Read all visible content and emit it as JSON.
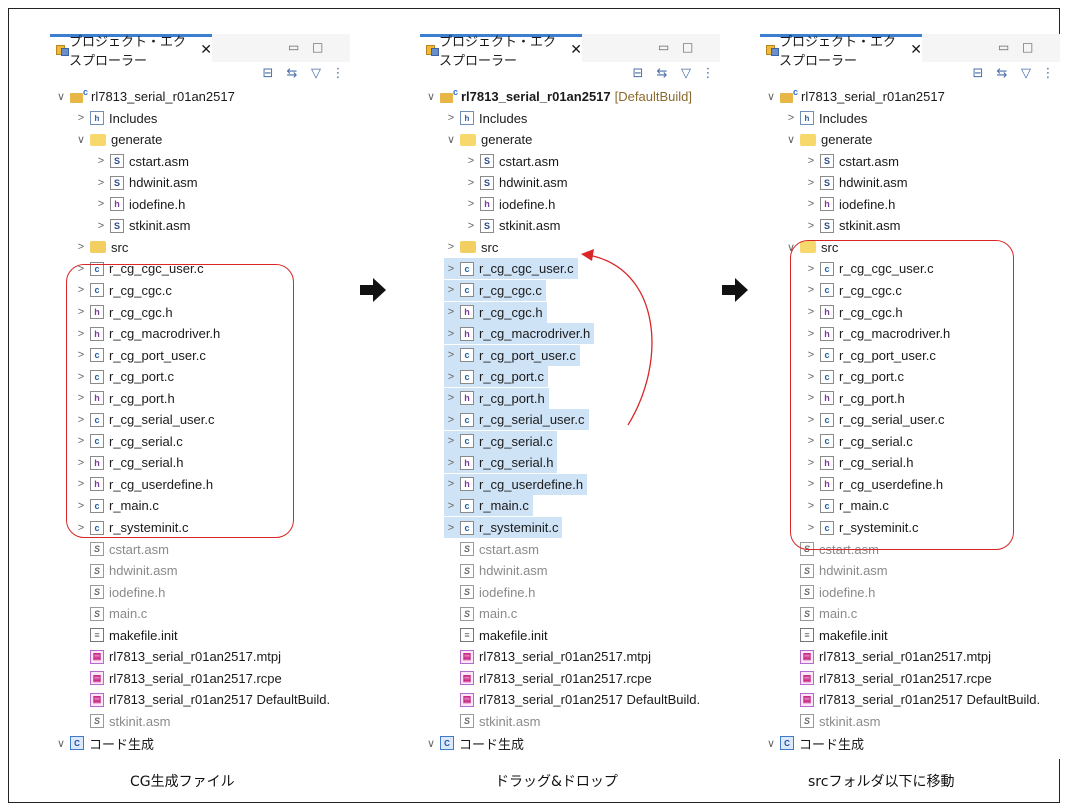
{
  "panels": [
    {
      "tab_title": "プロジェクト・エクスプローラー",
      "rows": [
        {
          "label": "rl7813_serial_r01an2517",
          "icon": "proj",
          "arrow": "∨",
          "indent": 0,
          "bold": false
        },
        {
          "label": "Includes",
          "icon": "inc",
          "arrow": ">",
          "indent": 1
        },
        {
          "label": "generate",
          "icon": "folder-open",
          "arrow": "∨",
          "indent": 1
        },
        {
          "label": "cstart.asm",
          "icon": "s",
          "arrow": ">",
          "indent": 2
        },
        {
          "label": "hdwinit.asm",
          "icon": "s",
          "arrow": ">",
          "indent": 2
        },
        {
          "label": "iodefine.h",
          "icon": "h",
          "arrow": ">",
          "indent": 2
        },
        {
          "label": "stkinit.asm",
          "icon": "s",
          "arrow": ">",
          "indent": 2
        },
        {
          "label": "src",
          "icon": "folder",
          "arrow": ">",
          "indent": 1
        },
        {
          "label": "r_cg_cgc_user.c",
          "icon": "c",
          "arrow": ">",
          "indent": 1
        },
        {
          "label": "r_cg_cgc.c",
          "icon": "c",
          "arrow": ">",
          "indent": 1
        },
        {
          "label": "r_cg_cgc.h",
          "icon": "h",
          "arrow": ">",
          "indent": 1
        },
        {
          "label": "r_cg_macrodriver.h",
          "icon": "h",
          "arrow": ">",
          "indent": 1
        },
        {
          "label": "r_cg_port_user.c",
          "icon": "c",
          "arrow": ">",
          "indent": 1
        },
        {
          "label": "r_cg_port.c",
          "icon": "c",
          "arrow": ">",
          "indent": 1
        },
        {
          "label": "r_cg_port.h",
          "icon": "h",
          "arrow": ">",
          "indent": 1
        },
        {
          "label": "r_cg_serial_user.c",
          "icon": "c",
          "arrow": ">",
          "indent": 1
        },
        {
          "label": "r_cg_serial.c",
          "icon": "c",
          "arrow": ">",
          "indent": 1
        },
        {
          "label": "r_cg_serial.h",
          "icon": "h",
          "arrow": ">",
          "indent": 1
        },
        {
          "label": "r_cg_userdefine.h",
          "icon": "h",
          "arrow": ">",
          "indent": 1
        },
        {
          "label": "r_main.c",
          "icon": "c",
          "arrow": ">",
          "indent": 1
        },
        {
          "label": "r_systeminit.c",
          "icon": "c",
          "arrow": ">",
          "indent": 1
        },
        {
          "label": "cstart.asm",
          "icon": "a",
          "arrow": "",
          "indent": 1,
          "dim": true
        },
        {
          "label": "hdwinit.asm",
          "icon": "a",
          "arrow": "",
          "indent": 1,
          "dim": true
        },
        {
          "label": "iodefine.h",
          "icon": "a",
          "arrow": "",
          "indent": 1,
          "dim": true
        },
        {
          "label": "main.c",
          "icon": "a",
          "arrow": "",
          "indent": 1,
          "dim": true
        },
        {
          "label": "makefile.init",
          "icon": "m",
          "arrow": "",
          "indent": 1
        },
        {
          "label": "rl7813_serial_r01an2517.mtpj",
          "icon": "p",
          "arrow": "",
          "indent": 1
        },
        {
          "label": "rl7813_serial_r01an2517.rcpe",
          "icon": "p",
          "arrow": "",
          "indent": 1
        },
        {
          "label": "rl7813_serial_r01an2517 DefaultBuild.",
          "icon": "p",
          "arrow": "",
          "indent": 1
        },
        {
          "label": "stkinit.asm",
          "icon": "a",
          "arrow": "",
          "indent": 1,
          "dim": true
        },
        {
          "label": "コード生成",
          "icon": "codegen",
          "arrow": "∨",
          "indent": 0
        }
      ],
      "caption": "CG生成ファイル"
    },
    {
      "tab_title": "プロジェクト・エクスプローラー",
      "rows": [
        {
          "label": "rl7813_serial_r01an2517",
          "suffix": "[DefaultBuild]",
          "icon": "proj",
          "arrow": "∨",
          "indent": 0,
          "bold": true
        },
        {
          "label": "Includes",
          "icon": "inc",
          "arrow": ">",
          "indent": 1
        },
        {
          "label": "generate",
          "icon": "folder-open",
          "arrow": "∨",
          "indent": 1
        },
        {
          "label": "cstart.asm",
          "icon": "s",
          "arrow": ">",
          "indent": 2
        },
        {
          "label": "hdwinit.asm",
          "icon": "s",
          "arrow": ">",
          "indent": 2
        },
        {
          "label": "iodefine.h",
          "icon": "h",
          "arrow": ">",
          "indent": 2
        },
        {
          "label": "stkinit.asm",
          "icon": "s",
          "arrow": ">",
          "indent": 2
        },
        {
          "label": "src",
          "icon": "folder",
          "arrow": ">",
          "indent": 1
        },
        {
          "label": "r_cg_cgc_user.c",
          "icon": "c",
          "arrow": ">",
          "indent": 1,
          "hl": true
        },
        {
          "label": "r_cg_cgc.c",
          "icon": "c",
          "arrow": ">",
          "indent": 1,
          "hl": true
        },
        {
          "label": "r_cg_cgc.h",
          "icon": "h",
          "arrow": ">",
          "indent": 1,
          "hl": true
        },
        {
          "label": "r_cg_macrodriver.h",
          "icon": "h",
          "arrow": ">",
          "indent": 1,
          "hl": true
        },
        {
          "label": "r_cg_port_user.c",
          "icon": "c",
          "arrow": ">",
          "indent": 1,
          "hl": true
        },
        {
          "label": "r_cg_port.c",
          "icon": "c",
          "arrow": ">",
          "indent": 1,
          "hl": true
        },
        {
          "label": "r_cg_port.h",
          "icon": "h",
          "arrow": ">",
          "indent": 1,
          "hl": true
        },
        {
          "label": "r_cg_serial_user.c",
          "icon": "c",
          "arrow": ">",
          "indent": 1,
          "hl": true
        },
        {
          "label": "r_cg_serial.c",
          "icon": "c",
          "arrow": ">",
          "indent": 1,
          "hl": true
        },
        {
          "label": "r_cg_serial.h",
          "icon": "h",
          "arrow": ">",
          "indent": 1,
          "hl": true
        },
        {
          "label": "r_cg_userdefine.h",
          "icon": "h",
          "arrow": ">",
          "indent": 1,
          "hl": true
        },
        {
          "label": "r_main.c",
          "icon": "c",
          "arrow": ">",
          "indent": 1,
          "hl": true
        },
        {
          "label": "r_systeminit.c",
          "icon": "c",
          "arrow": ">",
          "indent": 1,
          "hl": true
        },
        {
          "label": "cstart.asm",
          "icon": "a",
          "arrow": "",
          "indent": 1,
          "dim": true
        },
        {
          "label": "hdwinit.asm",
          "icon": "a",
          "arrow": "",
          "indent": 1,
          "dim": true
        },
        {
          "label": "iodefine.h",
          "icon": "a",
          "arrow": "",
          "indent": 1,
          "dim": true
        },
        {
          "label": "main.c",
          "icon": "a",
          "arrow": "",
          "indent": 1,
          "dim": true
        },
        {
          "label": "makefile.init",
          "icon": "m",
          "arrow": "",
          "indent": 1
        },
        {
          "label": "rl7813_serial_r01an2517.mtpj",
          "icon": "p",
          "arrow": "",
          "indent": 1
        },
        {
          "label": "rl7813_serial_r01an2517.rcpe",
          "icon": "p",
          "arrow": "",
          "indent": 1
        },
        {
          "label": "rl7813_serial_r01an2517 DefaultBuild.",
          "icon": "p",
          "arrow": "",
          "indent": 1
        },
        {
          "label": "stkinit.asm",
          "icon": "a",
          "arrow": "",
          "indent": 1,
          "dim": true
        },
        {
          "label": "コード生成",
          "icon": "codegen",
          "arrow": "∨",
          "indent": 0
        }
      ],
      "caption": "ドラッグ&ドロップ"
    },
    {
      "tab_title": "プロジェクト・エクスプローラー",
      "rows": [
        {
          "label": "rl7813_serial_r01an2517",
          "icon": "proj",
          "arrow": "∨",
          "indent": 0
        },
        {
          "label": "Includes",
          "icon": "inc",
          "arrow": ">",
          "indent": 1
        },
        {
          "label": "generate",
          "icon": "folder-open",
          "arrow": "∨",
          "indent": 1
        },
        {
          "label": "cstart.asm",
          "icon": "s",
          "arrow": ">",
          "indent": 2
        },
        {
          "label": "hdwinit.asm",
          "icon": "s",
          "arrow": ">",
          "indent": 2
        },
        {
          "label": "iodefine.h",
          "icon": "h",
          "arrow": ">",
          "indent": 2
        },
        {
          "label": "stkinit.asm",
          "icon": "s",
          "arrow": ">",
          "indent": 2
        },
        {
          "label": "src",
          "icon": "folder-open",
          "arrow": "∨",
          "indent": 1
        },
        {
          "label": "r_cg_cgc_user.c",
          "icon": "c",
          "arrow": ">",
          "indent": 2
        },
        {
          "label": "r_cg_cgc.c",
          "icon": "c",
          "arrow": ">",
          "indent": 2
        },
        {
          "label": "r_cg_cgc.h",
          "icon": "h",
          "arrow": ">",
          "indent": 2
        },
        {
          "label": "r_cg_macrodriver.h",
          "icon": "h",
          "arrow": ">",
          "indent": 2
        },
        {
          "label": "r_cg_port_user.c",
          "icon": "c",
          "arrow": ">",
          "indent": 2
        },
        {
          "label": "r_cg_port.c",
          "icon": "c",
          "arrow": ">",
          "indent": 2
        },
        {
          "label": "r_cg_port.h",
          "icon": "h",
          "arrow": ">",
          "indent": 2
        },
        {
          "label": "r_cg_serial_user.c",
          "icon": "c",
          "arrow": ">",
          "indent": 2
        },
        {
          "label": "r_cg_serial.c",
          "icon": "c",
          "arrow": ">",
          "indent": 2
        },
        {
          "label": "r_cg_serial.h",
          "icon": "h",
          "arrow": ">",
          "indent": 2
        },
        {
          "label": "r_cg_userdefine.h",
          "icon": "h",
          "arrow": ">",
          "indent": 2
        },
        {
          "label": "r_main.c",
          "icon": "c",
          "arrow": ">",
          "indent": 2
        },
        {
          "label": "r_systeminit.c",
          "icon": "c",
          "arrow": ">",
          "indent": 2
        },
        {
          "label": "cstart.asm",
          "icon": "a",
          "arrow": "",
          "indent": 1,
          "dim": true
        },
        {
          "label": "hdwinit.asm",
          "icon": "a",
          "arrow": "",
          "indent": 1,
          "dim": true
        },
        {
          "label": "iodefine.h",
          "icon": "a",
          "arrow": "",
          "indent": 1,
          "dim": true
        },
        {
          "label": "main.c",
          "icon": "a",
          "arrow": "",
          "indent": 1,
          "dim": true
        },
        {
          "label": "makefile.init",
          "icon": "m",
          "arrow": "",
          "indent": 1
        },
        {
          "label": "rl7813_serial_r01an2517.mtpj",
          "icon": "p",
          "arrow": "",
          "indent": 1
        },
        {
          "label": "rl7813_serial_r01an2517.rcpe",
          "icon": "p",
          "arrow": "",
          "indent": 1
        },
        {
          "label": "rl7813_serial_r01an2517 DefaultBuild.",
          "icon": "p",
          "arrow": "",
          "indent": 1
        },
        {
          "label": "stkinit.asm",
          "icon": "a",
          "arrow": "",
          "indent": 1,
          "dim": true
        },
        {
          "label": "コード生成",
          "icon": "codegen",
          "arrow": "∨",
          "indent": 0
        }
      ],
      "caption": "srcフォルダ以下に移動"
    }
  ],
  "icons": {
    "close": "close-icon",
    "minimize": "minimize-icon",
    "maximize": "maximize-icon",
    "collapse_all": "collapse-all-icon",
    "link_editor": "link-editor-icon",
    "filter": "filter-icon",
    "view_menu": "view-menu-icon"
  },
  "colors": {
    "tab_accent": "#3c7fd0",
    "selection": "#cfe3f7",
    "annotation_red": "#d92626"
  }
}
